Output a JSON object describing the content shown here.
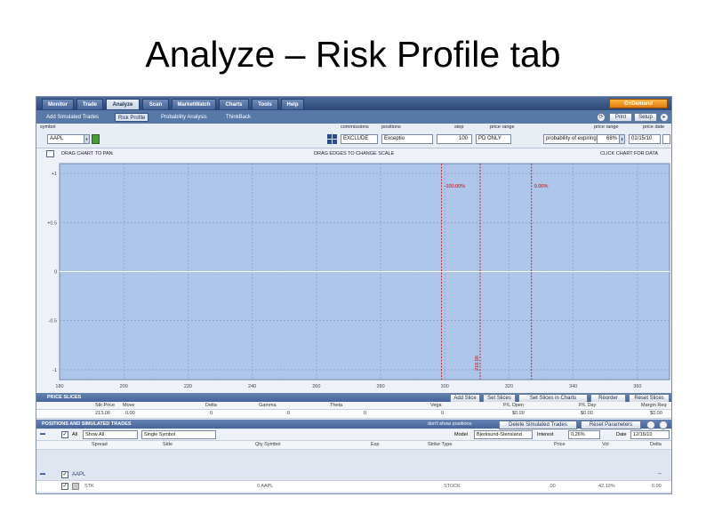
{
  "slide": {
    "title": "Analyze – Risk Profile tab"
  },
  "main_tabs": [
    {
      "label": "Monitor"
    },
    {
      "label": "Trade"
    },
    {
      "label": "Analyze"
    },
    {
      "label": "Scan"
    },
    {
      "label": "MarketWatch"
    },
    {
      "label": "Charts"
    },
    {
      "label": "Tools"
    },
    {
      "label": "Help"
    }
  ],
  "active_main_tab": "Analyze",
  "on_demand_label": "OnDemand",
  "sub_tabs": [
    {
      "label": "Add Simulated Trades"
    },
    {
      "label": "Risk Profile"
    },
    {
      "label": "Probability Analysis"
    },
    {
      "label": "ThinkBack"
    }
  ],
  "header_buttons": {
    "print": "Print",
    "setup": "Setup"
  },
  "params": {
    "symbol_label": "symbol",
    "symbol_value": "AAPL",
    "commissions_label": "commissions",
    "commissions_value": "EXCLUDE",
    "positions_label": "positions",
    "positions_value": "Exceptio",
    "step_label": "step",
    "step_value": "100",
    "price_range_label": "price range",
    "price_range_value": "PD ONLY",
    "probability_label": "probability of expiring",
    "price_range2_label": "price range",
    "price_range2_value": "68%",
    "date_label": "price date",
    "date_value": "01/15/10"
  },
  "chart_header": {
    "left": "DRAG CHART TO PAN",
    "center": "DRAG EDGES TO CHANGE SCALE",
    "right": "CLICK CHART FOR DATA"
  },
  "chart_data": {
    "type": "line",
    "title": "",
    "xlabel": "",
    "ylabel": "",
    "x_ticks": [
      180,
      190,
      200,
      210,
      220,
      230,
      240,
      250,
      260,
      270,
      280,
      290,
      300,
      310,
      320,
      330,
      340,
      350,
      360,
      370
    ],
    "y_ticks": [
      1,
      0.5,
      0,
      -0.5,
      -1
    ],
    "y_tick_labels": [
      "+1",
      "+0.5",
      "0",
      "-0.5",
      "-1"
    ],
    "xlim": [
      180,
      370
    ],
    "ylim": [
      -1.1,
      1.1
    ],
    "grid": true,
    "series": [
      {
        "x": [
          180,
          370
        ],
        "y": [
          0,
          0
        ]
      }
    ],
    "vertical_markers": [
      {
        "x": 299,
        "label": "-100.00%",
        "label_position": "top",
        "color": "#cc0000"
      },
      {
        "x": 311,
        "label": "210.00",
        "label_position": "bottom",
        "color": "#cc0000"
      },
      {
        "x": 327,
        "label": "0.00%",
        "label_position": "top",
        "color": "#cc0000"
      }
    ],
    "plot_background": "#aec6ea"
  },
  "price_slices": {
    "section_label": "PRICE SLICES",
    "buttons": [
      "Add Slice",
      "Set Slices",
      "Set Slices in Charts",
      "Reorder",
      "Reset Slices"
    ],
    "columns": [
      "Stk Price",
      "Move",
      "Delta",
      "Gamma",
      "Theta",
      "Vega",
      "P/L Open",
      "P/L Day",
      "Margin Req"
    ],
    "row": [
      "213.00",
      "0.00",
      "0",
      "0",
      "0",
      "0",
      "$0.00",
      "$0.00",
      "$0.00"
    ]
  },
  "positions": {
    "section_label": "POSITIONS AND SIMULATED TRADES",
    "dont_show_text": "don't show positions",
    "buttons": [
      "Delete Simulated Trades",
      "Reset Parameters"
    ],
    "filter": {
      "all_label": "All",
      "show_value": "Show All",
      "symbol_value": "Single Symbol",
      "model_label": "Model",
      "model_value": "Bjerksund-Stensland",
      "interest_label": "Interest",
      "interest_value": "0.26%",
      "date_label": "Date",
      "date_value": "12/16/10"
    },
    "columns": [
      "Spread",
      "Side",
      "Qty Symbol",
      "Exp",
      "Strike Type",
      "Price",
      "Vol",
      "Delta"
    ],
    "group_label": "AAPL",
    "row": [
      "STK",
      "",
      "0 AAPL",
      "",
      "STOCK",
      ".00",
      "42.13%",
      "0.00"
    ]
  },
  "colors": {
    "accent": "#45639a",
    "plot": "#aec6ea",
    "marker": "#cc0000",
    "on_demand": "#f29a26"
  }
}
